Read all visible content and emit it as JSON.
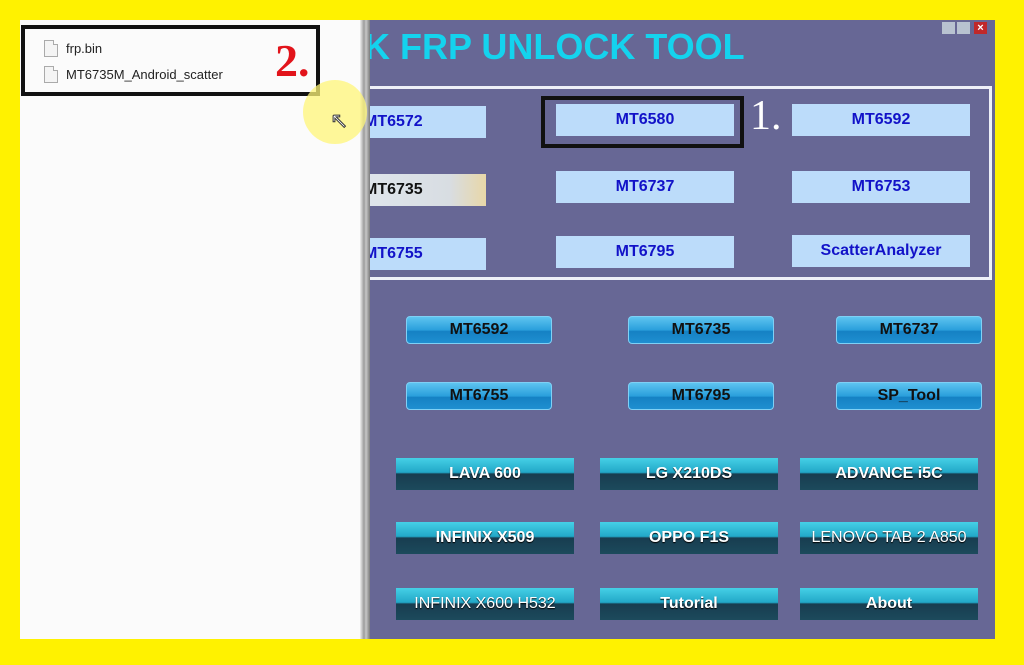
{
  "file_panel": {
    "files": [
      {
        "name": "frp.bin",
        "icon": "file-icon"
      },
      {
        "name": "MT6735M_Android_scatter",
        "icon": "file-icon"
      }
    ]
  },
  "annotations": {
    "step1": "1.",
    "step2": "2."
  },
  "app": {
    "title": "K FRP UNLOCK TOOL",
    "window_controls": [
      "minimize",
      "restore",
      "close"
    ],
    "chip_buttons": [
      {
        "label": "MT6572",
        "state": "normal"
      },
      {
        "label": "MT6580",
        "state": "highlighted"
      },
      {
        "label": "MT6592",
        "state": "normal"
      },
      {
        "label": "MT6735",
        "state": "selected"
      },
      {
        "label": "MT6737",
        "state": "normal"
      },
      {
        "label": "MT6753",
        "state": "normal"
      },
      {
        "label": "MT6755",
        "state": "normal"
      },
      {
        "label": "MT6795",
        "state": "normal"
      },
      {
        "label": "ScatterAnalyzer",
        "state": "normal"
      }
    ],
    "blue_buttons": [
      "MT6592",
      "MT6735",
      "MT6737",
      "MT6755",
      "MT6795",
      "SP_Tool"
    ],
    "device_buttons": [
      "LAVA 600",
      "LG X210DS",
      "ADVANCE i5C",
      "INFINIX X509",
      "OPPO F1S",
      "LENOVO TAB 2 A850",
      "INFINIX X600 H532",
      "Tutorial",
      "About"
    ]
  },
  "colors": {
    "frame": "#fff200",
    "app_bg": "#676795",
    "title": "#14d3ee",
    "chip_text": "#1212c8",
    "annotation_red": "#e2141b"
  }
}
